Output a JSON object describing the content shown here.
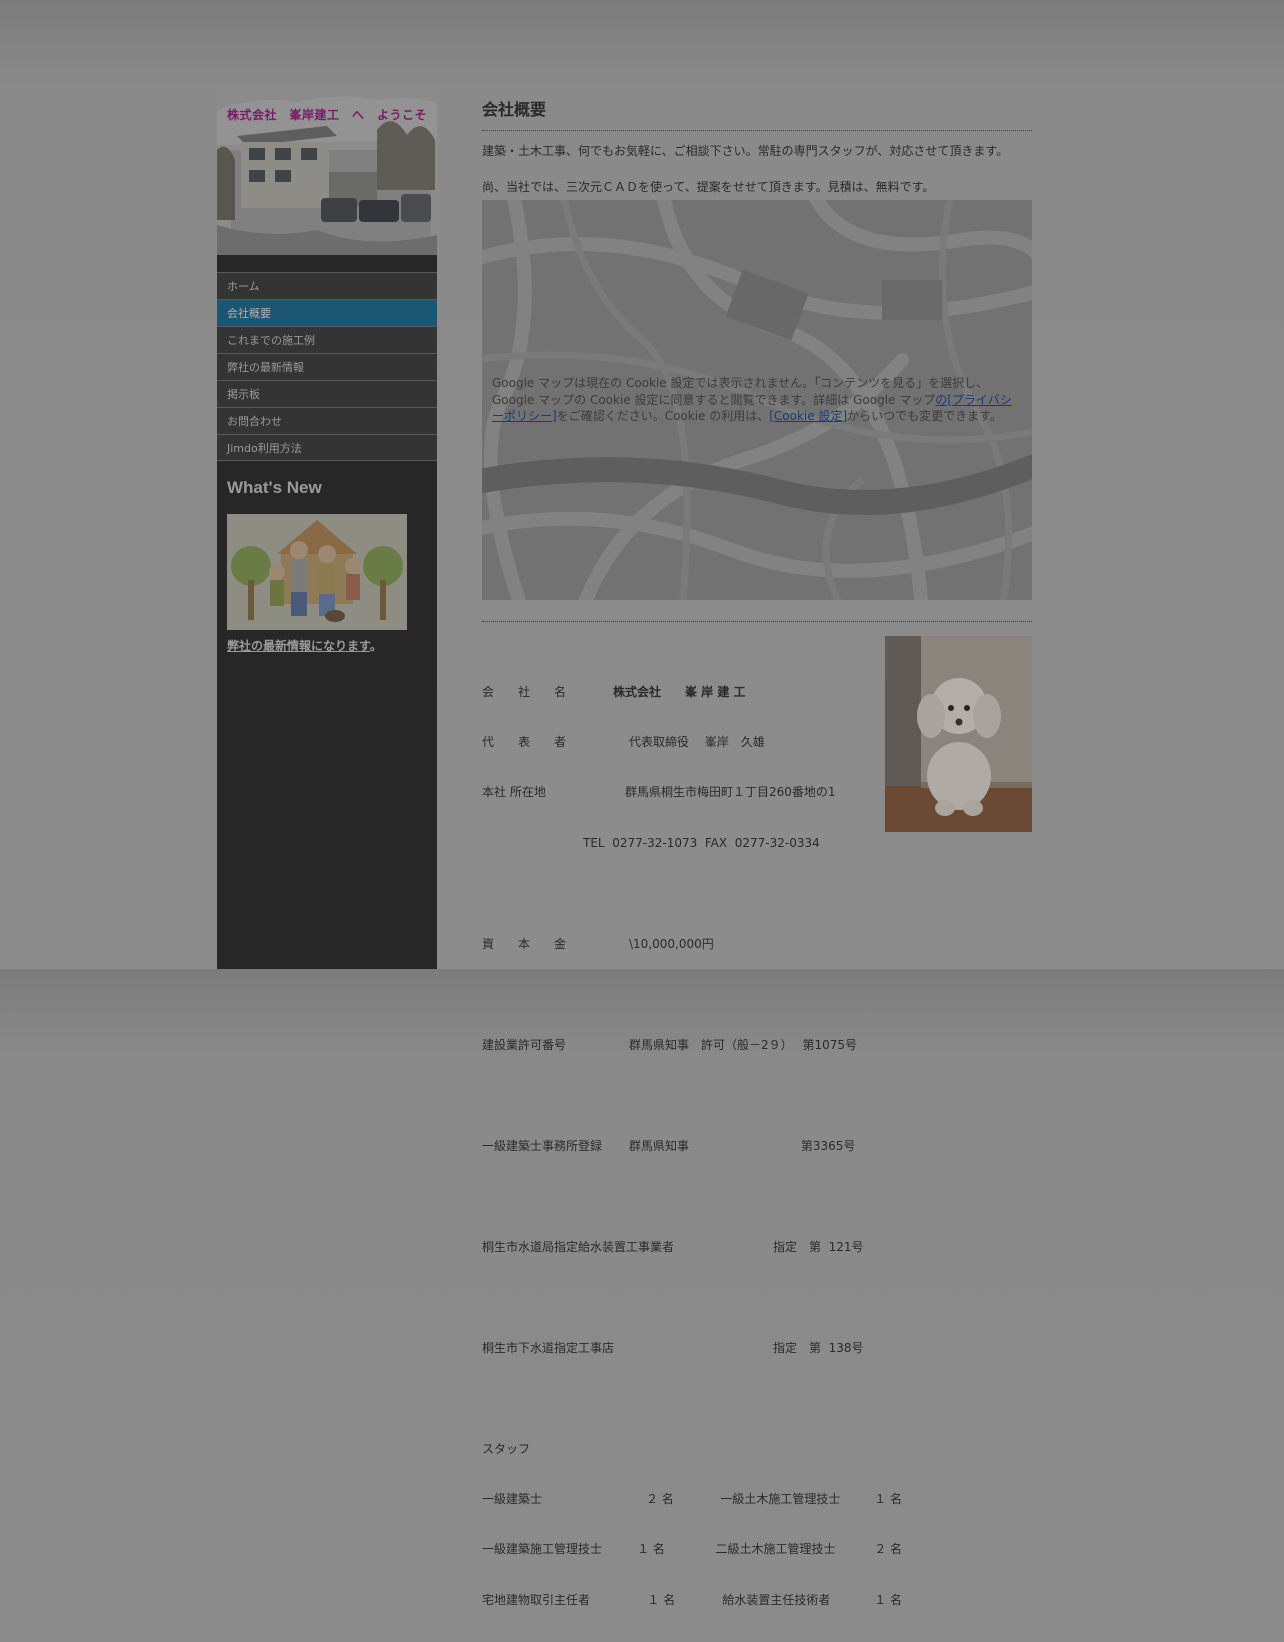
{
  "sidebar": {
    "header_title": "株式会社　峯岸建工　へ　ようこそ",
    "nav": [
      {
        "label": "ホーム"
      },
      {
        "label": "会社概要",
        "active": true
      },
      {
        "label": "これまでの施工例"
      },
      {
        "label": "弊社の最新情報"
      },
      {
        "label": "掲示板"
      },
      {
        "label": "お問合わせ"
      },
      {
        "label": "Jimdo利用方法"
      }
    ],
    "whats_new_title": "What's New",
    "whats_new_link": "弊社の最新情報になります",
    "whats_new_suffix": "。"
  },
  "main": {
    "title": "会社概要",
    "intro1": "建築・土木工事、何でもお気軽に、ご相談下さい。常駐の専門スタッフが、対応させて頂きます。",
    "intro2": "尚、当社では、三次元ＣＡＤを使って、提案をせせて頂きます。見積は、無料です。",
    "map_notice": {
      "text1": "Google マップは現在の Cookie 設定では表示されません。「コンテンツを見る」を選択し、Google マップの Cookie 設定に同意すると閲覧できます。詳細は Google マップ",
      "link1": "の[プライバシーポリシー]",
      "text2": "をご確認ください。Cookie の利用は、",
      "link2": "[Cookie 設定]",
      "text3": "からいつでも変更できます。"
    },
    "info_lines": [
      {
        "label": "会　　社　　名",
        "value": "株式会社　　峯 岸 建 工"
      },
      {
        "label": "代　　表　　者",
        "value": "代表取締役　 峯岸　久雄"
      },
      {
        "label": "本社 所在地",
        "value": "群馬県桐生市梅田町１丁目260番地の1"
      },
      {
        "label": "",
        "value": "TEL  0277-32-1073  FAX  0277-32-0334"
      },
      {
        "label": "資　　本　　金",
        "value": "\\10,000,000円"
      },
      {
        "label": "建設業許可番号",
        "value": "群馬県知事　許可（般－2９）　 第1075号"
      },
      {
        "label": "一級建築士事務所登録",
        "value": "群馬県知事　　　　　　　　　 第3365号"
      },
      {
        "label": "桐生市水道局指定給水装置工事業者",
        "value": "指定　第  121号"
      },
      {
        "label": "桐生市下水道指定工事店",
        "value": "指定　第  138号"
      },
      {
        "label": "スタッフ",
        "value": ""
      }
    ],
    "staff": [
      [
        "一級建築士",
        "２ 名",
        "一級土木施工管理技士",
        "１ 名"
      ],
      [
        "一級建築施工管理技士",
        "１ 名",
        "二級土木施工管理技士",
        "２ 名"
      ],
      [
        "宅地建物取引主任者",
        "１ 名",
        "給水装置主任技術者",
        "１ 名"
      ]
    ]
  }
}
